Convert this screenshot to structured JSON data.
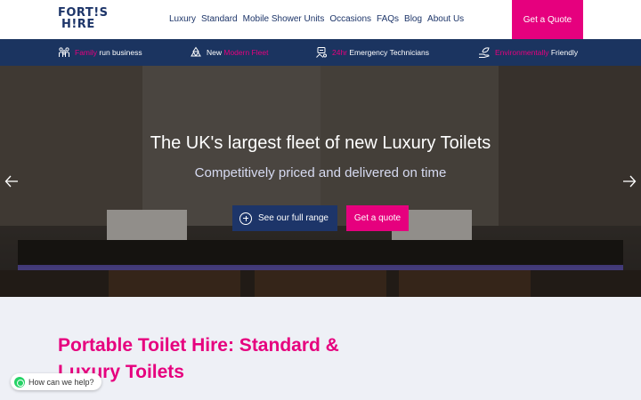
{
  "header": {
    "logo_line1": "FORT!S",
    "logo_line2": "H!RE",
    "nav": [
      "Luxury",
      "Standard",
      "Mobile Shower Units",
      "Occasions",
      "FAQs",
      "Blog",
      "About Us"
    ],
    "cta": "Get a Quote"
  },
  "infobar": {
    "items": [
      {
        "highlight": "Family",
        "text": " run business",
        "icon": "people-icon"
      },
      {
        "prefix": "New ",
        "highlight": "Modern Fleet",
        "icon": "recycle-icon"
      },
      {
        "highlight": "24hr",
        "text": " Emergency Technicians",
        "icon": "technician-icon"
      },
      {
        "highlight": "Environmentally",
        "text": " Friendly",
        "icon": "hand-leaf-icon"
      }
    ]
  },
  "hero": {
    "title": "The UK's largest fleet of new Luxury Toilets",
    "subtitle": "Competitively priced and delivered on time",
    "range_button": "See our full range",
    "quote_button": "Get a quote"
  },
  "content": {
    "title": "Portable Toilet Hire: Standard & Luxury Toilets"
  },
  "chat": {
    "label": "How can we help?"
  },
  "colors": {
    "brand_navy": "#1d3569",
    "brand_pink": "#e6007e",
    "infobar_bg": "#1b3460"
  }
}
